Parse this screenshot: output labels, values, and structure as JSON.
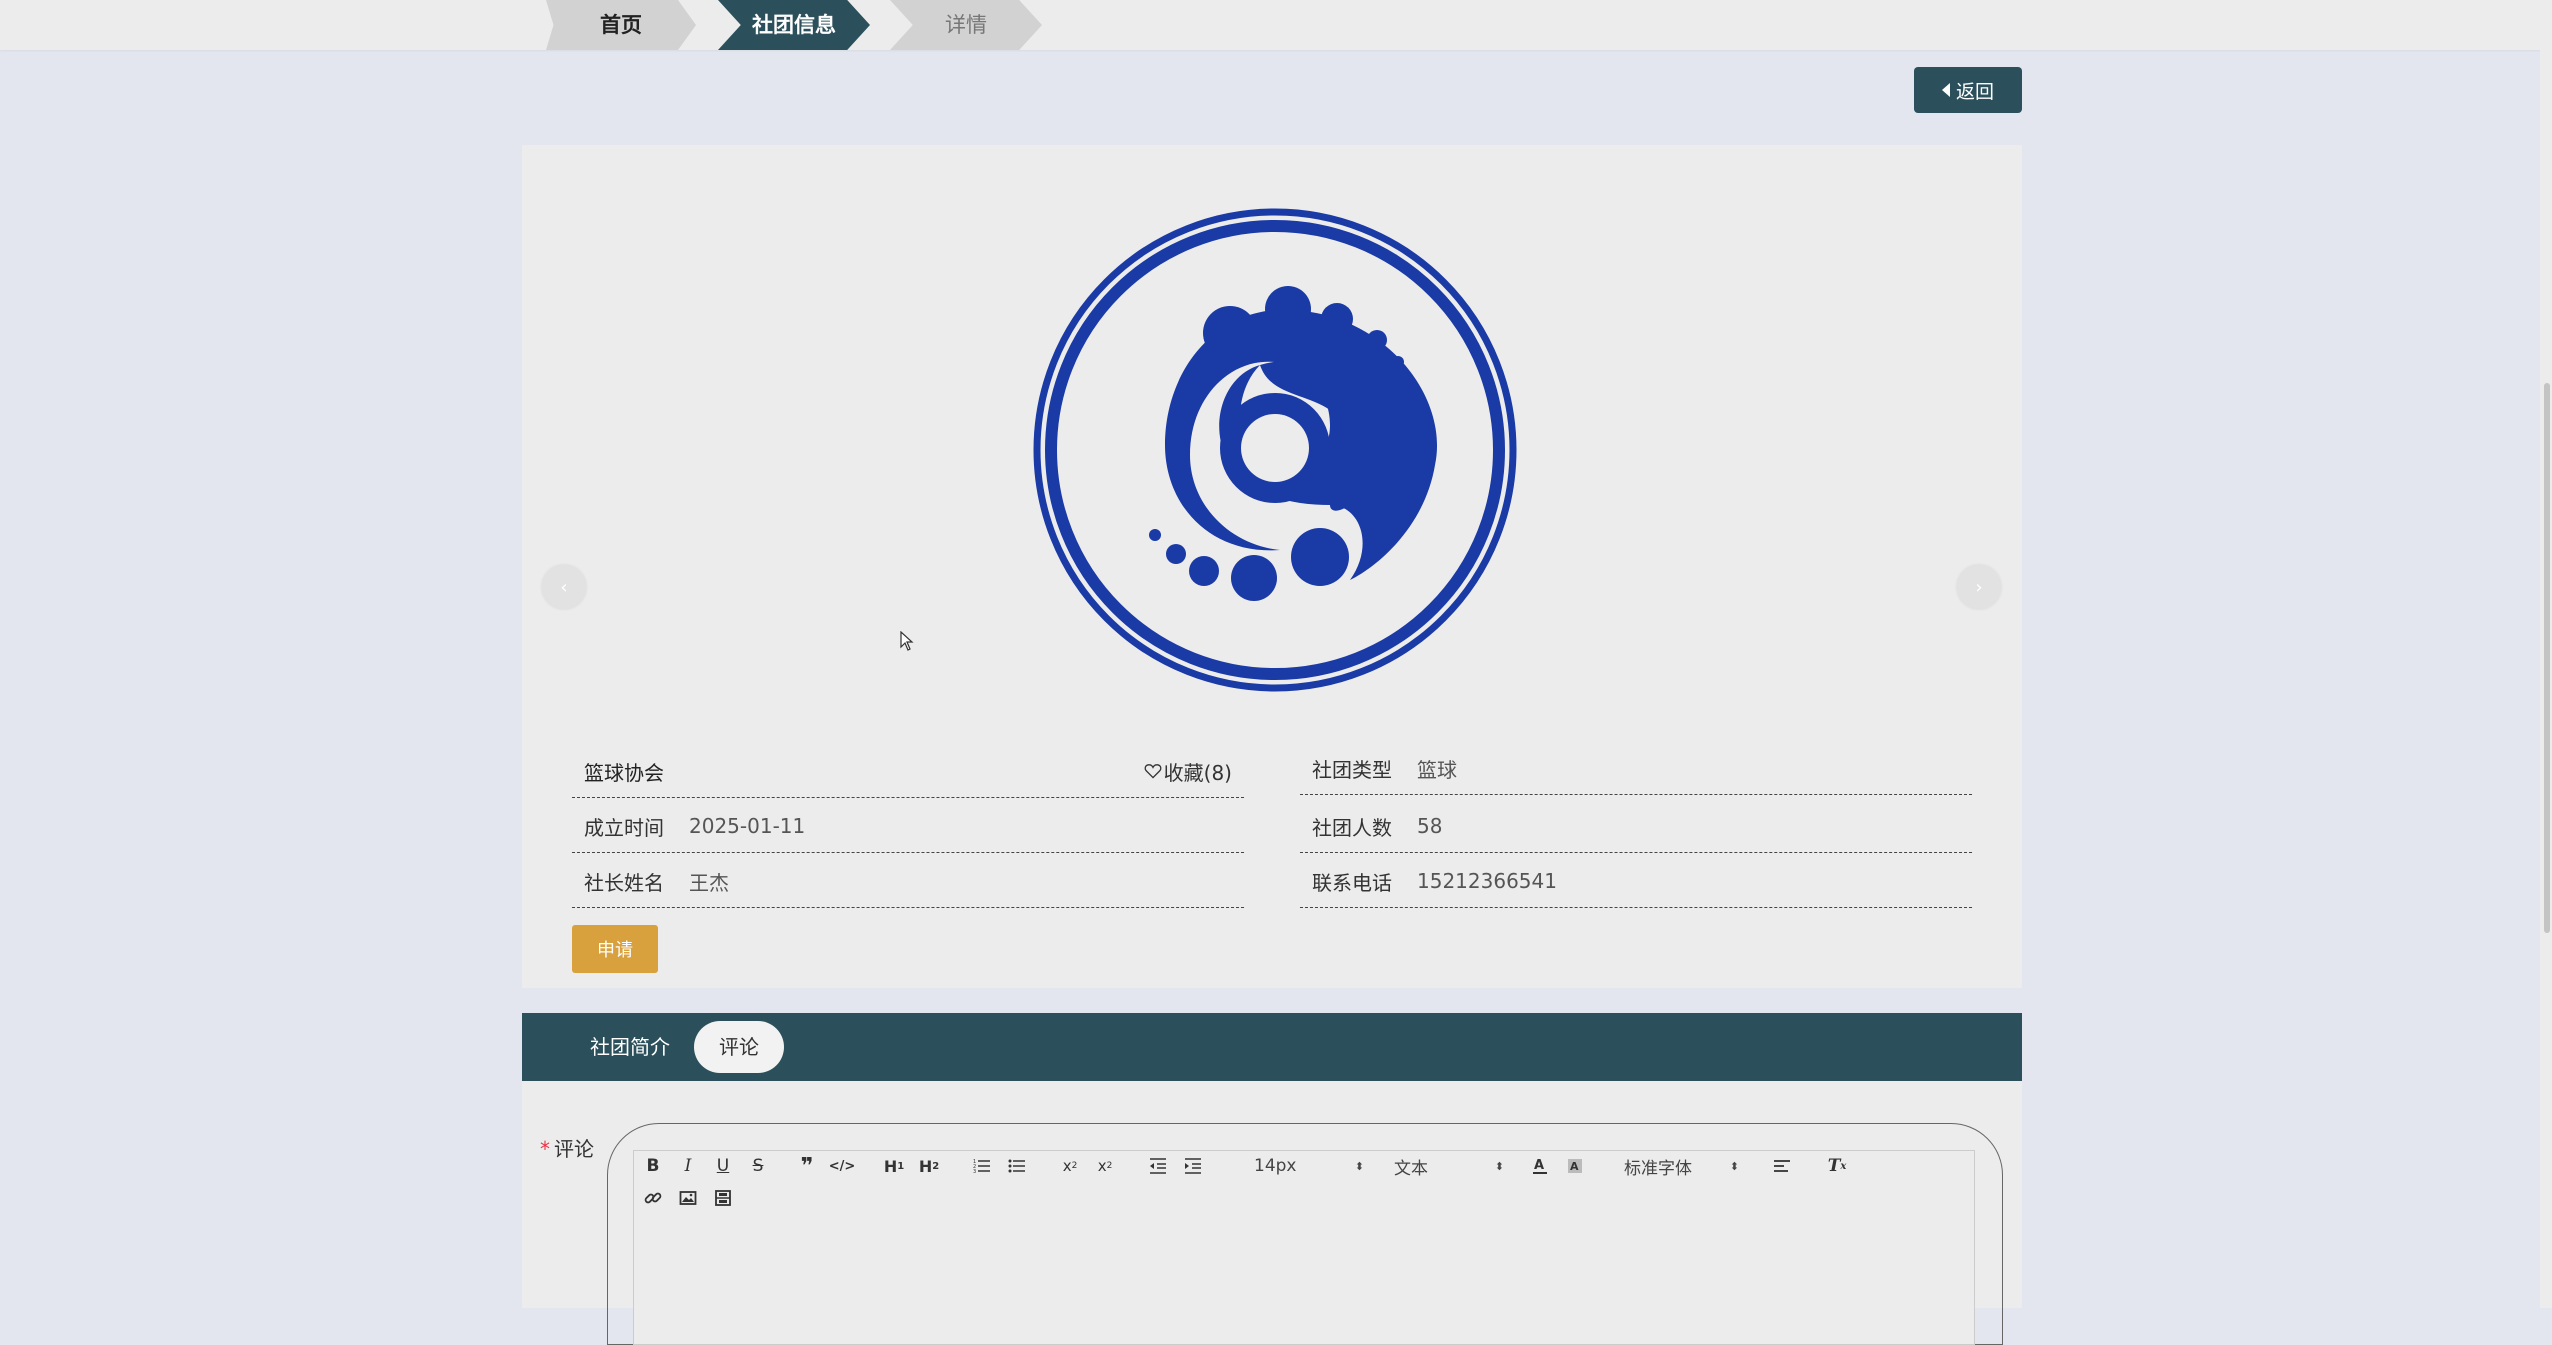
{
  "breadcrumb": {
    "items": [
      "首页",
      "社团信息",
      "详情"
    ]
  },
  "back_button": {
    "label": "返回"
  },
  "club": {
    "name": "篮球协会",
    "favorite_label": "收藏(8)",
    "fields": {
      "founded": {
        "label": "成立时间",
        "value": "2025-01-11"
      },
      "president": {
        "label": "社长姓名",
        "value": "王杰"
      },
      "type": {
        "label": "社团类型",
        "value": "篮球"
      },
      "members": {
        "label": "社团人数",
        "value": "58"
      },
      "phone": {
        "label": "联系电话",
        "value": "15212366541"
      }
    },
    "apply_label": "申请"
  },
  "tabs": [
    {
      "label": "社团简介",
      "active": false
    },
    {
      "label": "评论",
      "active": true
    }
  ],
  "comment": {
    "label": "评论",
    "required_mark": "*",
    "editor": {
      "font_size": "14px",
      "heading": "文本",
      "font_family": "标准字体"
    }
  },
  "colors": {
    "primary": "#2b505c",
    "apply": "#d9a13d",
    "logo_blue": "#1a3aa6"
  }
}
